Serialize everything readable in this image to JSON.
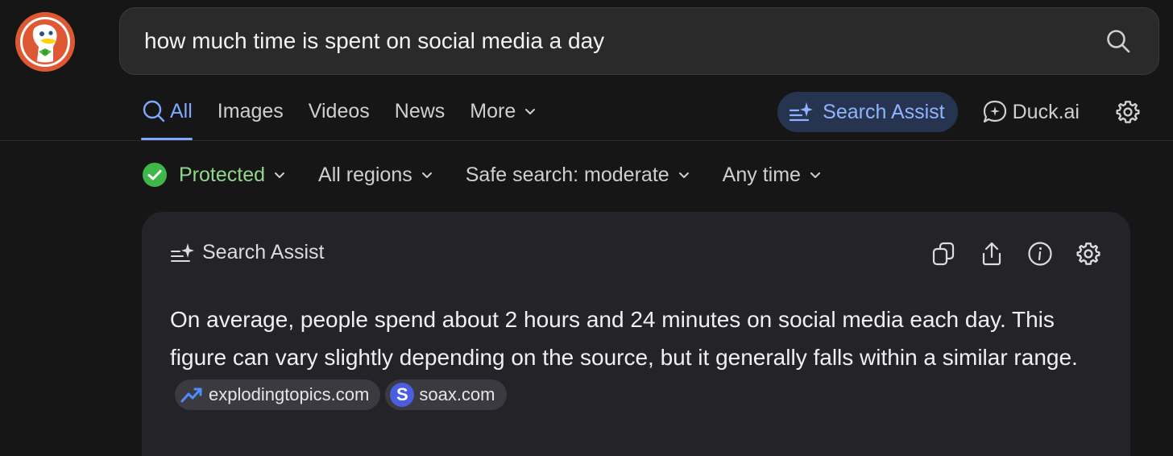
{
  "search": {
    "query": "how much time is spent on social media a day"
  },
  "tabs": [
    {
      "label": "All",
      "active": true
    },
    {
      "label": "Images",
      "active": false
    },
    {
      "label": "Videos",
      "active": false
    },
    {
      "label": "News",
      "active": false
    },
    {
      "label": "More",
      "active": false
    }
  ],
  "right_nav": {
    "search_assist_label": "Search Assist",
    "duck_ai_label": "Duck.ai"
  },
  "filters": {
    "protection": "Protected",
    "region": "All regions",
    "safe_search": "Safe search: moderate",
    "time": "Any time"
  },
  "assist_card": {
    "title": "Search Assist",
    "answer": "On average, people spend about 2 hours and 24 minutes on social media each day. This figure can vary slightly depending on the source, but it generally falls within a similar range.",
    "sources": [
      {
        "label": "explodingtopics.com",
        "icon": "trending-up-icon"
      },
      {
        "label": "soax.com",
        "icon": "soax-s-icon"
      }
    ]
  },
  "colors": {
    "background": "#161616",
    "accent_blue": "#7fa8ff",
    "protected_green": "#8fd88a",
    "card_bg": "#232328",
    "logo_orange": "#de5833"
  }
}
